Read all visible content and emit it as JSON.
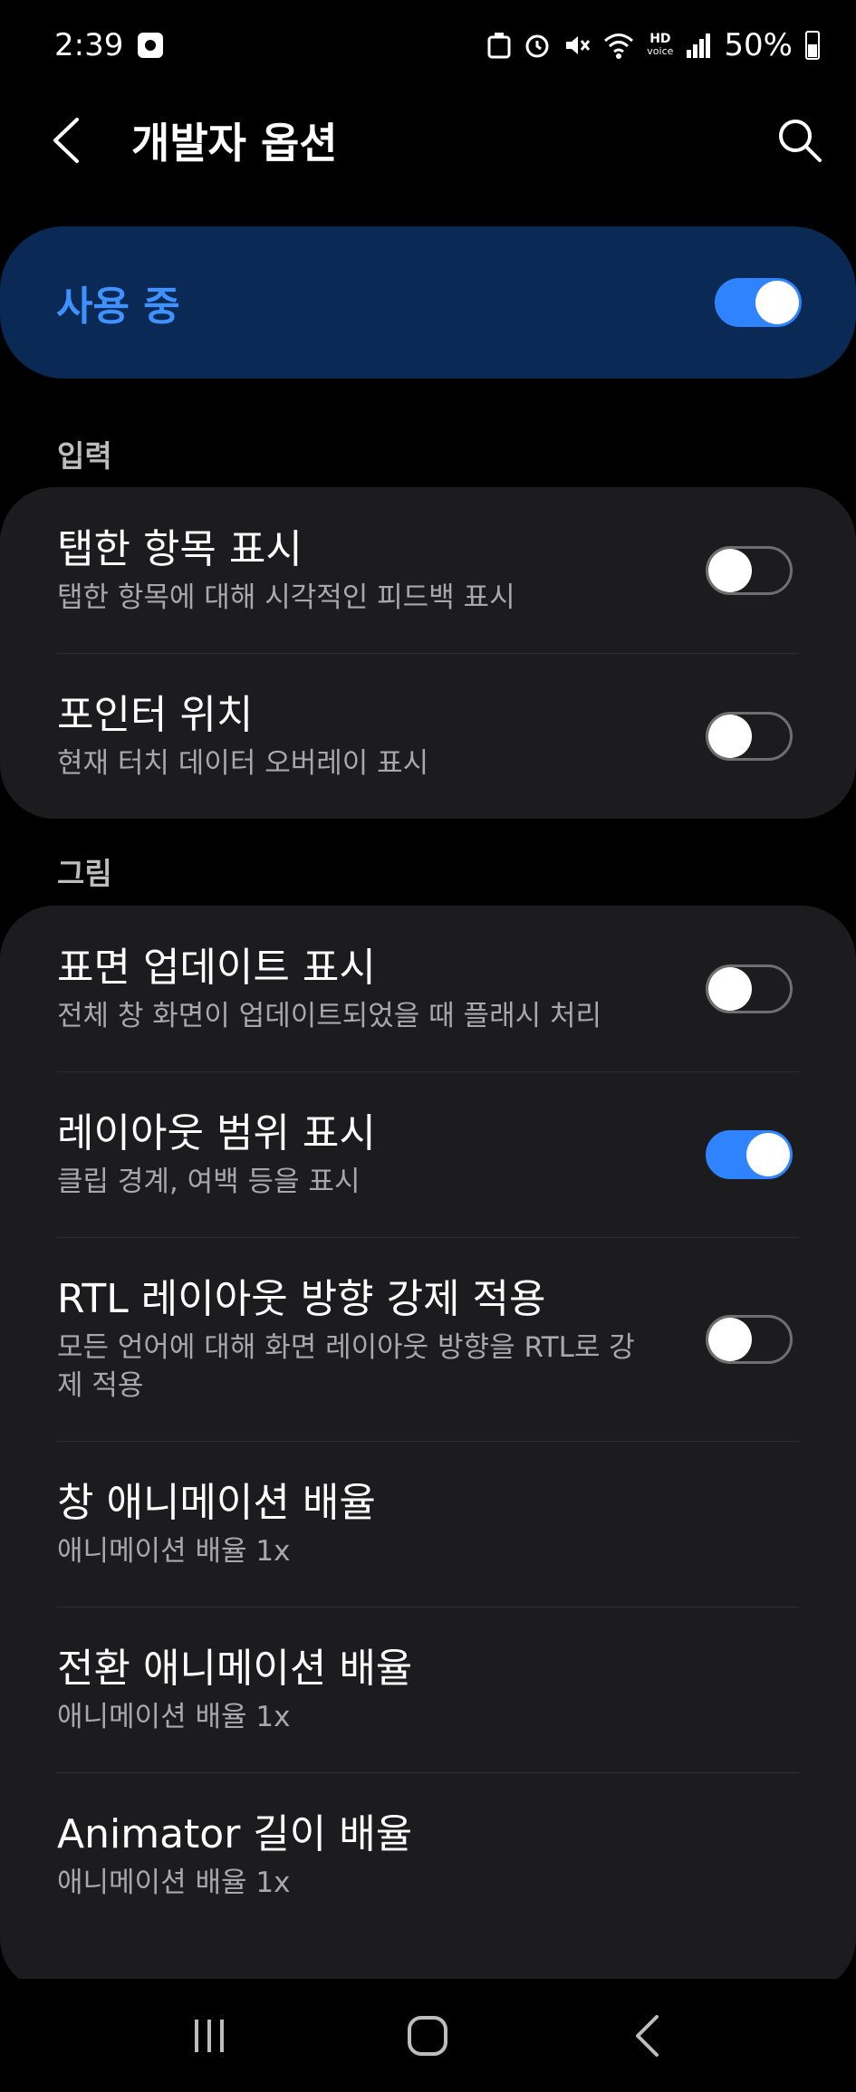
{
  "status_bar": {
    "time": "2:39",
    "battery": "50%",
    "hd_top": "HD",
    "hd_bottom": "voice"
  },
  "app_bar": {
    "title": "개발자 옵션"
  },
  "master_switch": {
    "label": "사용 중",
    "on": true
  },
  "sections": {
    "input": {
      "header": "입력",
      "items": [
        {
          "title": "탭한 항목 표시",
          "subtitle": "탭한 항목에 대해 시각적인 피드백 표시",
          "on": false
        },
        {
          "title": "포인터 위치",
          "subtitle": "현재 터치 데이터 오버레이 표시",
          "on": false
        }
      ]
    },
    "drawing": {
      "header": "그림",
      "items": [
        {
          "title": "표면 업데이트 표시",
          "subtitle": "전체 창 화면이 업데이트되었을 때 플래시 처리",
          "on": false
        },
        {
          "title": "레이아웃 범위 표시",
          "subtitle": "클립 경계, 여백 등을 표시",
          "on": true
        },
        {
          "title": "RTL 레이아웃 방향 강제 적용",
          "subtitle": "모든 언어에 대해 화면 레이아웃 방향을 RTL로 강제 적용",
          "on": false
        },
        {
          "title": "창 애니메이션 배율",
          "subtitle": "애니메이션 배율 1x"
        },
        {
          "title": "전환 애니메이션 배율",
          "subtitle": "애니메이션 배율 1x"
        },
        {
          "title": "Animator 길이 배율",
          "subtitle": "애니메이션 배율 1x"
        }
      ]
    }
  },
  "colors": {
    "accent": "#3e91ff",
    "switch_on": "#2f83ff",
    "card_bg": "#1c1c1e",
    "master_bg": "#0a2a55"
  },
  "icons": {
    "back": "chevron-left-icon",
    "search": "search-icon",
    "nav_recents": "recents-icon",
    "nav_home": "home-icon",
    "nav_back": "back-icon"
  }
}
